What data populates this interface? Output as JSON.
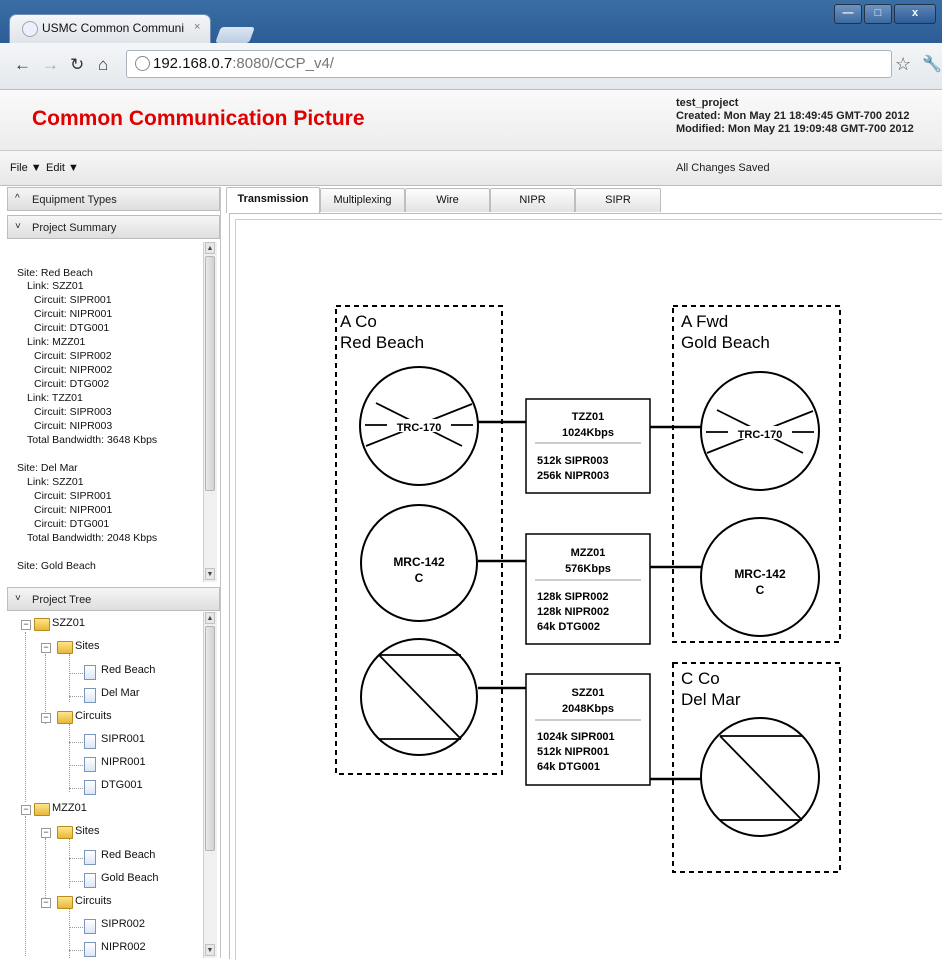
{
  "browser": {
    "tab_title": "USMC Common Communi",
    "tab_close": "×",
    "url_host": "192.168.0.7",
    "url_rest": ":8080/CCP_v4/",
    "window_buttons": [
      "—",
      "□",
      "x"
    ]
  },
  "app": {
    "title": "Common Communication Picture",
    "project_name": "test_project",
    "created": "Created: Mon May 21 18:49:45 GMT-700 2012",
    "modified": "Modified: Mon May 21 19:09:48 GMT-700 2012",
    "status": "All Changes Saved"
  },
  "menu": {
    "file": "File ▼",
    "edit": "Edit ▼"
  },
  "panels": {
    "equipment": {
      "label": "Equipment Types",
      "arrow": "^"
    },
    "summary": {
      "label": "Project Summary",
      "arrow": "˅"
    },
    "tree": {
      "label": "Project Tree",
      "arrow": "˅"
    }
  },
  "summary_lines": [
    "Site: Red Beach",
    "Link: SZZ01",
    "Circuit: SIPR001",
    "Circuit: NIPR001",
    "Circuit: DTG001",
    "Link: MZZ01",
    "Circuit: SIPR002",
    "Circuit: NIPR002",
    "Circuit: DTG002",
    "Link: TZZ01",
    "Circuit: SIPR003",
    "Circuit: NIPR003",
    "Total Bandwidth: 3648 Kbps",
    "Site: Del Mar",
    "Link: SZZ01",
    "Circuit: SIPR001",
    "Circuit: NIPR001",
    "Circuit: DTG001",
    "Total Bandwidth: 2048 Kbps",
    "Site: Gold Beach"
  ],
  "tree_nodes": [
    "SZZ01",
    "Sites",
    "Red Beach",
    "Del Mar",
    "Circuits",
    "SIPR001",
    "NIPR001",
    "DTG001",
    "MZZ01",
    "Sites",
    "Red Beach",
    "Gold Beach",
    "Circuits",
    "SIPR002",
    "NIPR002"
  ],
  "tabs": [
    "Transmission",
    "Multiplexing",
    "Wire",
    "NIPR",
    "SIPR"
  ],
  "diagram": {
    "sites": [
      {
        "line1": "A Co",
        "line2": "Red Beach"
      },
      {
        "line1": "A Fwd",
        "line2": "Gold Beach"
      },
      {
        "line1": "C Co",
        "line2": "Del Mar"
      }
    ],
    "equipment": [
      {
        "label": "TRC-170"
      },
      {
        "label": "MRC-142",
        "sub": "C"
      },
      {
        "label": "TRC-170"
      },
      {
        "label": "MRC-142",
        "sub": "C"
      }
    ],
    "links": [
      {
        "name": "TZZ01",
        "rate": "1024Kbps",
        "circuits": [
          "512k SIPR003",
          "256k NIPR003"
        ]
      },
      {
        "name": "MZZ01",
        "rate": "576Kbps",
        "circuits": [
          "128k SIPR002",
          "128k NIPR002",
          "64k DTG002"
        ]
      },
      {
        "name": "SZZ01",
        "rate": "2048Kbps",
        "circuits": [
          "1024k SIPR001",
          "512k NIPR001",
          "64k DTG001"
        ]
      }
    ]
  }
}
